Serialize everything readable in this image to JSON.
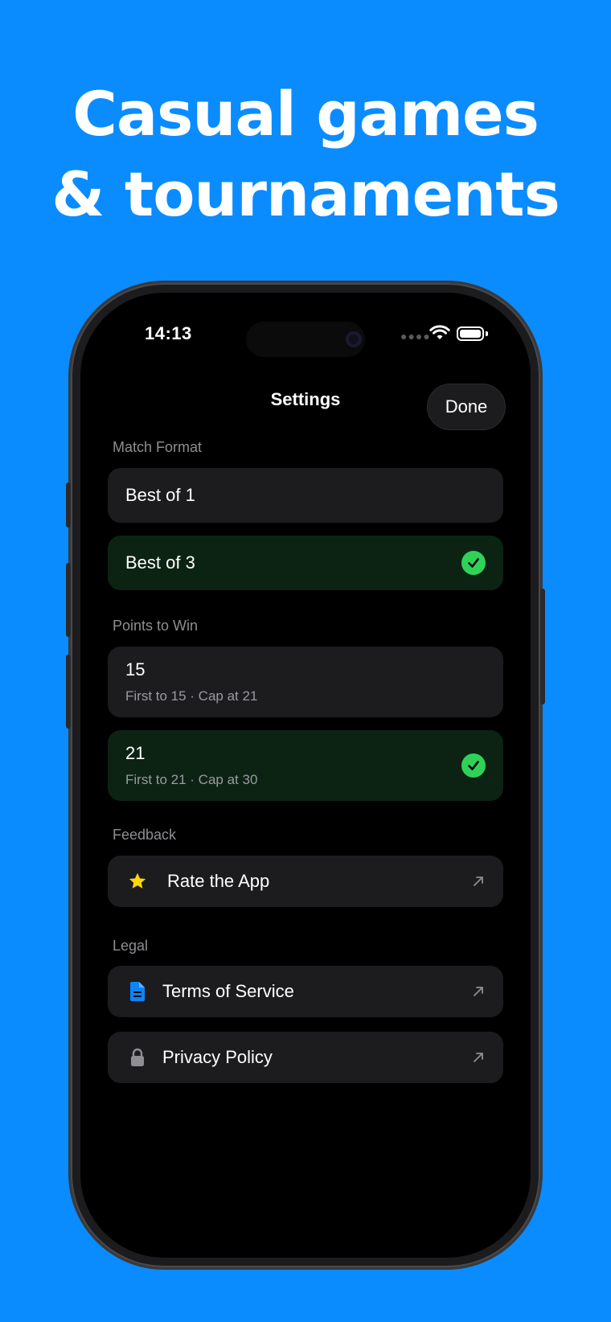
{
  "headline": {
    "line1": "Casual games",
    "line2": "& tournaments"
  },
  "status_bar": {
    "time": "14:13"
  },
  "nav": {
    "title": "Settings",
    "done_label": "Done"
  },
  "sections": {
    "match_format": {
      "label": "Match Format",
      "options": [
        {
          "label": "Best of 1",
          "selected": false
        },
        {
          "label": "Best of 3",
          "selected": true
        }
      ]
    },
    "points_to_win": {
      "label": "Points to Win",
      "options": [
        {
          "label": "15",
          "detail": "First to 15 · Cap at 21",
          "selected": false
        },
        {
          "label": "21",
          "detail": "First to 21 · Cap at 30",
          "selected": true
        }
      ]
    },
    "feedback": {
      "label": "Feedback",
      "items": [
        {
          "label": "Rate the App",
          "icon": "star-icon"
        }
      ]
    },
    "legal": {
      "label": "Legal",
      "items": [
        {
          "label": "Terms of Service",
          "icon": "document-icon"
        },
        {
          "label": "Privacy Policy",
          "icon": "lock-icon"
        }
      ]
    }
  },
  "colors": {
    "background": "#0a8cff",
    "selected_row": "#0c2314",
    "check": "#30d158",
    "star": "#ffd60a",
    "document": "#0a84ff"
  }
}
